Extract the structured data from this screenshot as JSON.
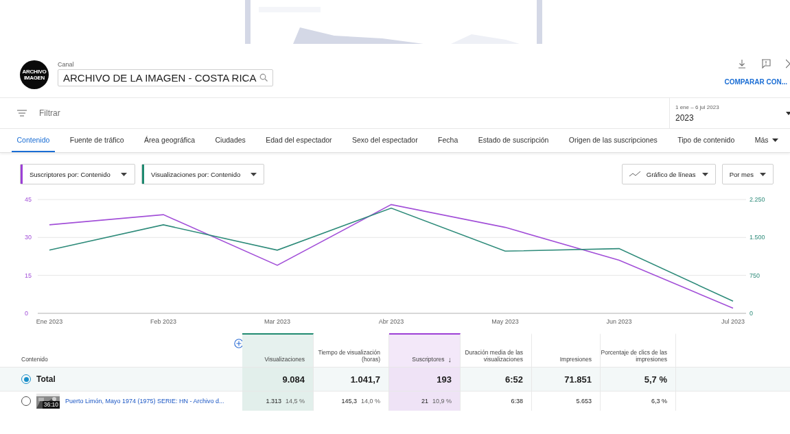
{
  "header": {
    "channel_label": "Canal",
    "channel_name": "ARCHIVO DE LA IMAGEN - COSTA RICA",
    "logo_lines": [
      "ARCHIVO",
      "IMAGEN"
    ],
    "compare": "COMPARAR CON..."
  },
  "filter": {
    "placeholder": "Filtrar"
  },
  "date_range": {
    "range": "1 ene – 6 jul 2023",
    "value": "2023"
  },
  "tabs": [
    {
      "label": "Contenido",
      "selected": true
    },
    {
      "label": "Fuente de tráfico",
      "selected": false
    },
    {
      "label": "Área geográfica",
      "selected": false
    },
    {
      "label": "Ciudades",
      "selected": false
    },
    {
      "label": "Edad del espectador",
      "selected": false
    },
    {
      "label": "Sexo del espectador",
      "selected": false
    },
    {
      "label": "Fecha",
      "selected": false
    },
    {
      "label": "Estado de suscripción",
      "selected": false
    },
    {
      "label": "Origen de las suscripciones",
      "selected": false
    },
    {
      "label": "Tipo de contenido",
      "selected": false
    },
    {
      "label": "Más",
      "selected": false
    }
  ],
  "metric_selectors": [
    {
      "label": "Suscriptores por: Contenido",
      "color": "#9c3fd6"
    },
    {
      "label": "Visualizaciones por: Contenido",
      "color": "#1f8a70"
    }
  ],
  "chart_controls": [
    "Gráfico de líneas",
    "Por mes"
  ],
  "chart": {
    "chart_data": {
      "type": "line",
      "categories": [
        "Ene 2023",
        "Feb 2023",
        "Mar 2023",
        "Abr 2023",
        "May 2023",
        "Jun 2023",
        "Jul 2023"
      ],
      "series": [
        {
          "color": "#a24fd8",
          "values": [
            35,
            39,
            19,
            43,
            34,
            21,
            2
          ]
        }
      ],
      "ylim": [
        0,
        45
      ],
      "yticks": [
        0,
        15,
        30,
        45
      ]
    }
  },
  "chart_right": {
    "chart_data": {
      "type": "line",
      "series": [
        {
          "color": "#2e8b7a",
          "values": [
            1250,
            1750,
            1250,
            2080,
            1230,
            1280,
            240
          ]
        }
      ],
      "ylim": [
        0,
        2250
      ],
      "yticks": [
        {
          "value": 0,
          "label": "0"
        },
        {
          "value": 750,
          "label": "750"
        },
        {
          "value": 1500,
          "label": "1.500"
        },
        {
          "value": 2250,
          "label": "2.250"
        }
      ]
    }
  },
  "table": {
    "columns": [
      {
        "label": "Contenido",
        "kind": "name"
      },
      {
        "label": "Visualizaciones",
        "kind": "views"
      },
      {
        "label": "Tiempo de visualización (horas)",
        "kind": "plain"
      },
      {
        "label": "Suscriptores",
        "kind": "subs",
        "sort": "↓"
      },
      {
        "label": "Duración media de las visualizaciones",
        "kind": "plain"
      },
      {
        "label": "Impresiones",
        "kind": "plain"
      },
      {
        "label": "Porcentaje de clics de las impresiones",
        "kind": "plain"
      }
    ],
    "total": {
      "selected": true,
      "cells": [
        "Total",
        "9.084",
        "1.041,7",
        "193",
        "6:52",
        "71.851",
        "5,7 %"
      ]
    },
    "rows": [
      {
        "duration": "36:10",
        "selected": false,
        "cells": [
          [
            "Puerto Limón, Mayo 1974 (1975) SERIE: HN - Archivo d..."
          ],
          [
            "1.313",
            "14,5 %"
          ],
          [
            "145,3",
            "14,0 %"
          ],
          [
            "21",
            "10,9 %"
          ],
          [
            "6:38"
          ],
          [
            "5.653"
          ],
          [
            "6,3 %"
          ]
        ]
      }
    ]
  }
}
